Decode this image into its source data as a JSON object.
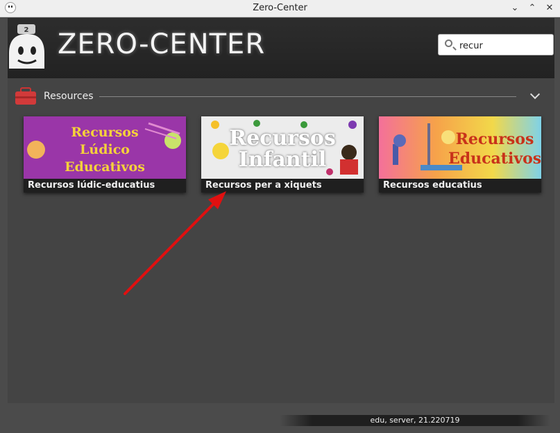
{
  "window": {
    "title": "Zero-Center",
    "minimize_glyph": "⌄",
    "maximize_glyph": "⌃",
    "close_glyph": "✕"
  },
  "header": {
    "brand": "ZERO-CENTER",
    "logo_badge": "2"
  },
  "search": {
    "value": "recur"
  },
  "section": {
    "label": "Resources"
  },
  "cards": [
    {
      "banner_lines": [
        "Recursos",
        "Lúdico",
        "Educativos"
      ],
      "caption": "Recursos lúdic-educatius"
    },
    {
      "banner_lines": [
        "Recursos",
        "Infantil"
      ],
      "caption": "Recursos per a xiquets"
    },
    {
      "banner_lines": [
        "Recursos",
        "Educativos"
      ],
      "caption": "Recursos educatius"
    }
  ],
  "status": {
    "text": "edu, server, 21.220719"
  },
  "colors": {
    "accent_arrow": "#e01010",
    "card1_bg": "#9a36a8",
    "card2_bg": "#ececec",
    "card3_bg": "#f4a040"
  }
}
